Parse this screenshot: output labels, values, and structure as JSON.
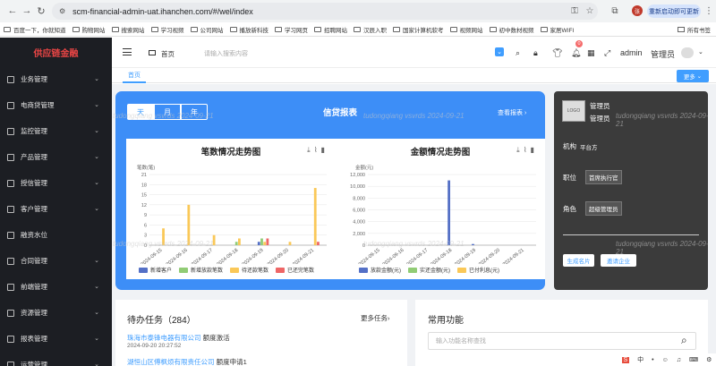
{
  "browser": {
    "url": "scm-financial-admin-uat.ihanchen.com/#/wel/index",
    "restart_label": "重新启动即可更新",
    "profile_initial": "张",
    "bookmarks": [
      "百度一下，你就知道",
      "购物网站",
      "搜索网站",
      "学习视频",
      "公司网站",
      "播放新科技",
      "学习网页",
      "招聘网站",
      "汉辰入职",
      "国家计算机软考",
      "视频网站",
      "初中数材视频",
      "家居WIFI"
    ],
    "all_bookmarks": "所有书签"
  },
  "sidebar": {
    "brand": "供应链金融",
    "items": [
      "业务管理",
      "电商贷管理",
      "监控管理",
      "产品管理",
      "授信管理",
      "客户管理",
      "融资水位",
      "合同管理",
      "前端管理",
      "资源管理",
      "报表管理",
      "运营管理"
    ]
  },
  "header": {
    "breadcrumb": "首页",
    "search_placeholder": "请输入搜索内容",
    "badge_count": "0",
    "username": "admin",
    "role": "管理员"
  },
  "tabs": {
    "home": "首页",
    "more": "更多"
  },
  "credit": {
    "segments": [
      "天",
      "月",
      "年"
    ],
    "title": "信贷报表",
    "view_report": "查看报表"
  },
  "chart_data": [
    {
      "type": "bar",
      "title": "笔数情况走势图",
      "ylabel": "笔数(笔)",
      "ylim": [
        0,
        21
      ],
      "yticks": [
        0,
        3,
        6,
        9,
        12,
        15,
        18,
        21
      ],
      "categories": [
        "2024-09-15",
        "2024-09-16",
        "2024-09-17",
        "2024-09-18",
        "2024-09-19",
        "2024-09-20",
        "2024-09-21"
      ],
      "series": [
        {
          "name": "新增客户",
          "color": "#5470c6",
          "values": [
            0,
            0,
            0,
            0,
            1,
            0,
            0
          ]
        },
        {
          "name": "新增放款笔数",
          "color": "#91cc75",
          "values": [
            0,
            0,
            0,
            1,
            2,
            0,
            0
          ]
        },
        {
          "name": "待还款笔数",
          "color": "#fac858",
          "values": [
            5,
            12,
            3,
            2,
            1,
            1,
            17
          ]
        },
        {
          "name": "已还完笔数",
          "color": "#ee6666",
          "values": [
            0,
            0,
            0,
            0,
            2,
            0,
            1
          ]
        }
      ]
    },
    {
      "type": "bar",
      "title": "金额情况走势图",
      "ylabel": "金额(元)",
      "ylim": [
        0,
        12000
      ],
      "yticks": [
        0,
        2000,
        4000,
        6000,
        8000,
        10000,
        12000
      ],
      "ytick_labels": [
        "0",
        "2,000",
        "4,000",
        "6,000",
        "8,000",
        "10,000",
        "12,000"
      ],
      "categories": [
        "2024-09-15",
        "2024-09-16",
        "2024-09-17",
        "2024-09-18",
        "2024-09-19",
        "2024-09-20",
        "2024-09-21"
      ],
      "series": [
        {
          "name": "放款金额(元)",
          "color": "#5470c6",
          "values": [
            0,
            0,
            0,
            11000,
            200,
            0,
            0
          ]
        },
        {
          "name": "实还金额(元)",
          "color": "#91cc75",
          "values": [
            0,
            0,
            0,
            0,
            0,
            0,
            0
          ]
        },
        {
          "name": "已付利息(元)",
          "color": "#fac858",
          "values": [
            0,
            0,
            0,
            0,
            0,
            0,
            0
          ]
        }
      ]
    }
  ],
  "user_card": {
    "logo": "LOGO",
    "name": "管理员",
    "role": "管理员",
    "org_label": "机构",
    "org_value": "平台方",
    "position_label": "职位",
    "position_value": "首席执行官",
    "role_label": "角色",
    "role_value": "超级管理员",
    "btn_card": "生成名片",
    "btn_invite": "邀请企业"
  },
  "todo": {
    "title": "待办任务（284）",
    "more": "更多任务",
    "items": [
      {
        "company": "珠海市泰锋电器有限公司",
        "action": "额度激活",
        "time": "2024-09-20 20:27:52"
      },
      {
        "company": "湖恒山区傅枫烦有限责任公司",
        "action": "额度申请1",
        "time": ""
      }
    ]
  },
  "common": {
    "title": "常用功能",
    "search_placeholder": "输入功能名称查找"
  },
  "watermark": "tudongqiang vsvrds 2024-09-21"
}
